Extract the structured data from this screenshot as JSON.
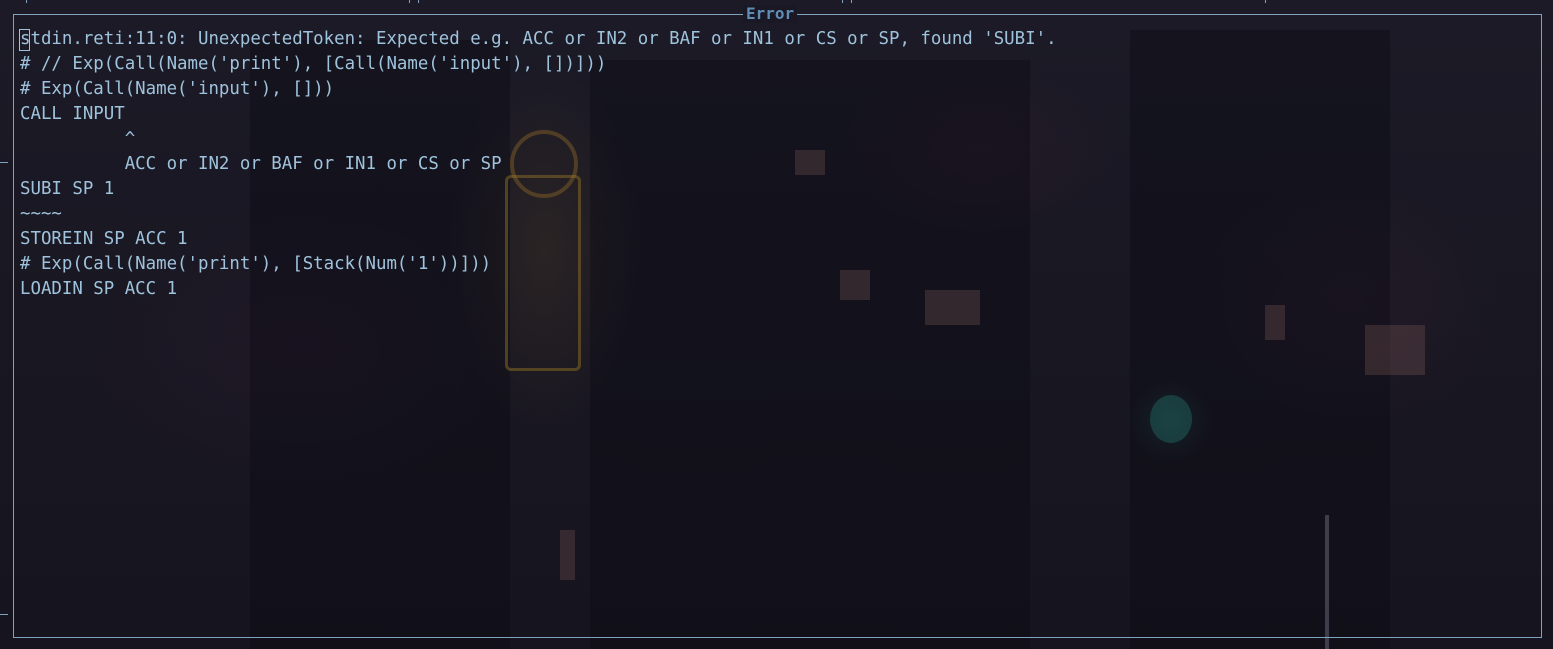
{
  "window": {
    "title": "Error"
  },
  "terminal": {
    "lines": [
      "stdin.reti:11:0: UnexpectedToken: Expected e.g. ACC or IN2 or BAF or IN1 or CS or SP, found 'SUBI'.",
      "# // Exp(Call(Name('print'), [Call(Name('input'), [])]))",
      "# Exp(Call(Name('input'), []))",
      "CALL INPUT",
      "          ^",
      "          ACC or IN2 or BAF or IN1 or CS or SP",
      "SUBI SP 1",
      "~~~~",
      "STOREIN SP ACC 1",
      "# Exp(Call(Name('print'), [Stack(Num('1'))]))",
      "LOADIN SP ACC 1"
    ]
  },
  "colors": {
    "text": "#9fc3dc",
    "border": "#7fa3bf",
    "title": "#5f8db5",
    "background": "#141621"
  }
}
